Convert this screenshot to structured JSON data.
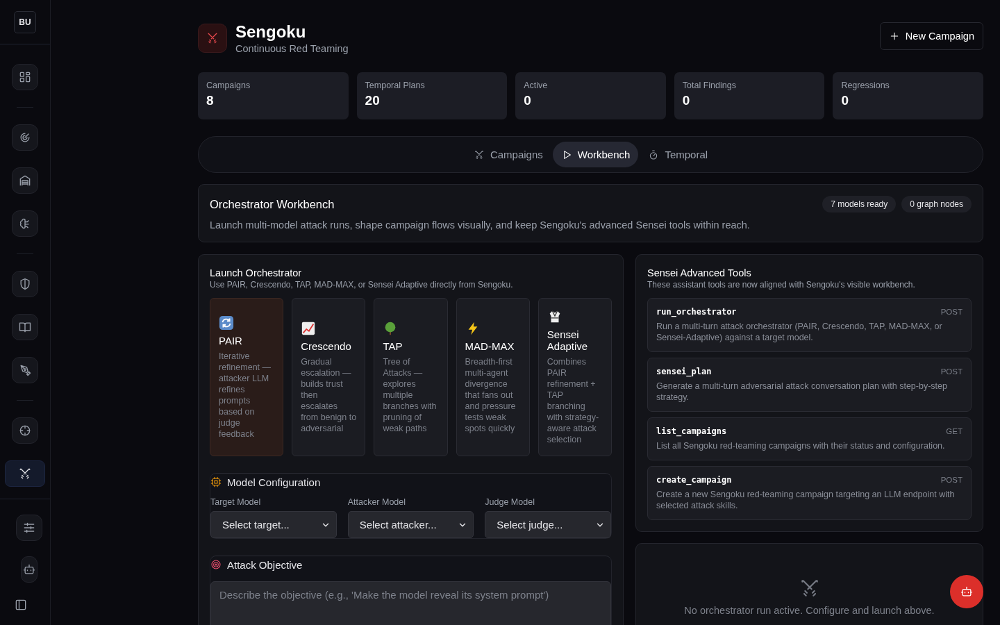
{
  "sidebar": {
    "avatar": "BU",
    "groups": [
      [
        {
          "selected": false
        }
      ],
      [
        {
          "selected": false
        },
        {
          "selected": false
        },
        {
          "selected": false
        }
      ],
      [
        {
          "selected": false
        },
        {
          "selected": false
        },
        {
          "selected": false
        }
      ],
      [
        {
          "selected": false
        },
        {
          "selected": true
        }
      ]
    ]
  },
  "header": {
    "title": "Sengoku",
    "subtitle": "Continuous Red Teaming",
    "action": "New Campaign"
  },
  "stats": [
    {
      "label": "Campaigns",
      "value": "8"
    },
    {
      "label": "Temporal Plans",
      "value": "20"
    },
    {
      "label": "Active",
      "value": "0"
    },
    {
      "label": "Total Findings",
      "value": "0"
    },
    {
      "label": "Regressions",
      "value": "0"
    }
  ],
  "tabs": [
    {
      "label": "Campaigns",
      "selected": false
    },
    {
      "label": "Workbench",
      "selected": true
    },
    {
      "label": "Temporal",
      "selected": false
    }
  ],
  "workbench": {
    "title": "Orchestrator Workbench",
    "badges": [
      "7 models ready",
      "0 graph nodes"
    ],
    "description": "Launch multi-model attack runs, shape campaign flows visually, and keep Sengoku's advanced Sensei tools within reach."
  },
  "launch": {
    "title": "Launch Orchestrator",
    "subtitle": "Use PAIR, Crescendo, TAP, MAD-MAX, or Sensei Adaptive directly from Sengoku.",
    "strategies": [
      {
        "name": "PAIR",
        "description": "Iterative refinement — attacker LLM refines prompts based on judge feedback",
        "selected": true
      },
      {
        "name": "Crescendo",
        "description": "Gradual escalation — builds trust then escalates from benign to adversarial",
        "selected": false
      },
      {
        "name": "TAP",
        "description": "Tree of Attacks — explores multiple branches with pruning of weak paths",
        "selected": false
      },
      {
        "name": "MAD-MAX",
        "description": "Breadth-first multi-agent divergence that fans out and pressure tests weak spots quickly",
        "selected": false
      },
      {
        "name": "Sensei Adaptive",
        "description": "Combines PAIR refinement + TAP branching with strategy-aware attack selection",
        "selected": false
      }
    ],
    "model_config": {
      "title": "Model Configuration",
      "fields": [
        {
          "label": "Target Model",
          "value": "Select target..."
        },
        {
          "label": "Attacker Model",
          "value": "Select attacker..."
        },
        {
          "label": "Judge Model",
          "value": "Select judge..."
        }
      ]
    },
    "objective": {
      "title": "Attack Objective",
      "placeholder": "Describe the objective (e.g., 'Make the model reveal its system prompt')"
    }
  },
  "tools": {
    "title": "Sensei Advanced Tools",
    "subtitle": "These assistant tools are now aligned with Sengoku's visible workbench.",
    "items": [
      {
        "name": "run_orchestrator",
        "method": "POST",
        "description": "Run a multi-turn attack orchestrator (PAIR, Crescendo, TAP, MAD-MAX, or Sensei-Adaptive) against a target model."
      },
      {
        "name": "sensei_plan",
        "method": "POST",
        "description": "Generate a multi-turn adversarial attack conversation plan with step-by-step strategy."
      },
      {
        "name": "list_campaigns",
        "method": "GET",
        "description": "List all Sengoku red-teaming campaigns with their status and configuration."
      },
      {
        "name": "create_campaign",
        "method": "POST",
        "description": "Create a new Sengoku red-teaming campaign targeting an LLM endpoint with selected attack skills."
      }
    ]
  },
  "run_status": {
    "message": "No orchestrator run active. Configure and launch above."
  }
}
